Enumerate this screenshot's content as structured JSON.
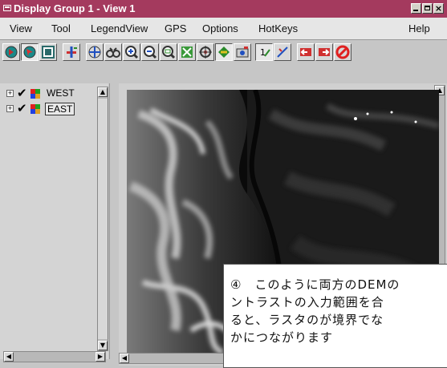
{
  "window": {
    "title": "Display Group 1 - View 1"
  },
  "menu": [
    "View",
    "Tool",
    "LegendView",
    "GPS",
    "Options",
    "HotKeys",
    "Help"
  ],
  "toolbar_icons": [
    "pointer-icon",
    "select-icon",
    "frame-icon",
    "add-layer-icon",
    "pan-icon",
    "binoculars-icon",
    "zoom-in-icon",
    "zoom-out-icon",
    "zoom-box-icon",
    "full-extent-icon",
    "locate-icon",
    "redraw-icon",
    "snapshot-icon",
    "one-to-one-icon",
    "measure-icon",
    "previous-view-icon",
    "next-view-icon",
    "cancel-icon"
  ],
  "legend": {
    "layers": [
      {
        "name": "WEST",
        "checked": true,
        "selected": false
      },
      {
        "name": "EAST",
        "checked": true,
        "selected": true
      }
    ]
  },
  "annotation": {
    "lines": [
      "④　このように両方のDEMの",
      "ントラストの入力範囲を合",
      "ると、ラスタのが境界でな",
      "かにつながります"
    ]
  },
  "colors": {
    "titlebar": "#a43a5e",
    "menubar": "#e6e6e6"
  }
}
